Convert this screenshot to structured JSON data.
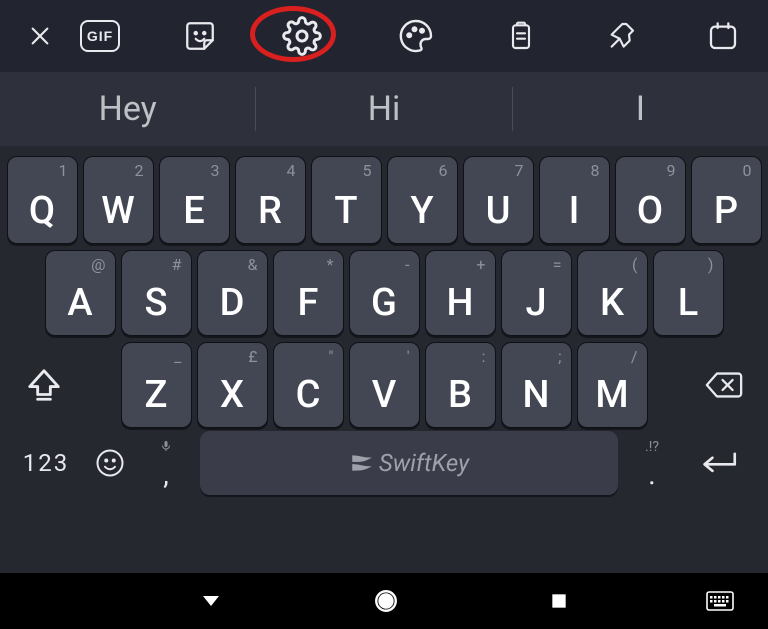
{
  "toolbar": {
    "gif_label": "GIF"
  },
  "suggestions": {
    "s1": "Hey",
    "s2": "Hi",
    "s3": "I"
  },
  "keys": {
    "row1": {
      "q": {
        "main": "Q",
        "sec": "1"
      },
      "w": {
        "main": "W",
        "sec": "2"
      },
      "e": {
        "main": "E",
        "sec": "3"
      },
      "r": {
        "main": "R",
        "sec": "4"
      },
      "t": {
        "main": "T",
        "sec": "5"
      },
      "y": {
        "main": "Y",
        "sec": "6"
      },
      "u": {
        "main": "U",
        "sec": "7"
      },
      "i": {
        "main": "I",
        "sec": "8"
      },
      "o": {
        "main": "O",
        "sec": "9"
      },
      "p": {
        "main": "P",
        "sec": "0"
      }
    },
    "row2": {
      "a": {
        "main": "A",
        "sec": "@"
      },
      "s": {
        "main": "S",
        "sec": "#"
      },
      "d": {
        "main": "D",
        "sec": "&"
      },
      "f": {
        "main": "F",
        "sec": "*"
      },
      "g": {
        "main": "G",
        "sec": "-"
      },
      "h": {
        "main": "H",
        "sec": "+"
      },
      "j": {
        "main": "J",
        "sec": "="
      },
      "k": {
        "main": "K",
        "sec": "("
      },
      "l": {
        "main": "L",
        "sec": ")"
      }
    },
    "row3": {
      "z": {
        "main": "Z",
        "sec": "_"
      },
      "x": {
        "main": "X",
        "sec": "£"
      },
      "c": {
        "main": "C",
        "sec": "\""
      },
      "v": {
        "main": "V",
        "sec": "'"
      },
      "b": {
        "main": "B",
        "sec": ":"
      },
      "n": {
        "main": "N",
        "sec": ";"
      },
      "m": {
        "main": "M",
        "sec": "/"
      }
    },
    "sym_label": "123",
    "comma": ",",
    "period": ".",
    "period_sec": ".!?",
    "space_label": "SwiftKey"
  }
}
